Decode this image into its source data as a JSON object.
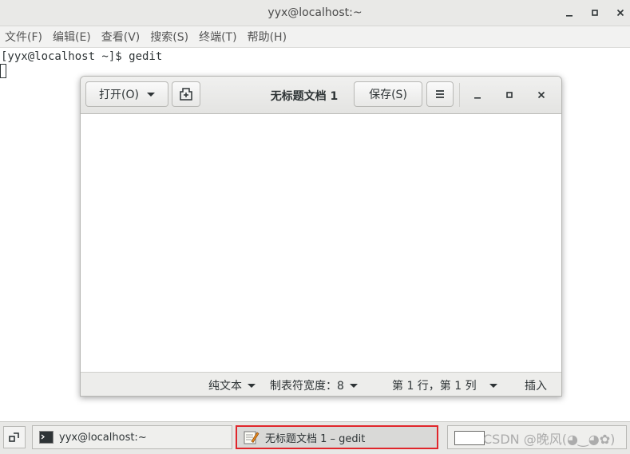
{
  "terminal": {
    "title": "yyx@localhost:~",
    "menu": [
      "文件(F)",
      "编辑(E)",
      "查看(V)",
      "搜索(S)",
      "终端(T)",
      "帮助(H)"
    ],
    "prompt_line": "[yyx@localhost ~]$ gedit"
  },
  "gedit": {
    "open_label": "打开(O)",
    "title": "无标题文档 1",
    "save_label": "保存(S)",
    "status": {
      "language": "纯文本",
      "tab_width": "制表符宽度：8",
      "position": "第 1 行，第 1 列",
      "mode": "插入"
    }
  },
  "taskbar": {
    "tasks": [
      {
        "label": "yyx@localhost:~",
        "icon": "terminal-icon"
      },
      {
        "label": "无标题文档 1 – gedit",
        "icon": "text-editor-icon"
      }
    ]
  },
  "watermark": "CSDN @晚风(◕‿◕✿)",
  "colors": {
    "highlight": "#e0262b"
  }
}
